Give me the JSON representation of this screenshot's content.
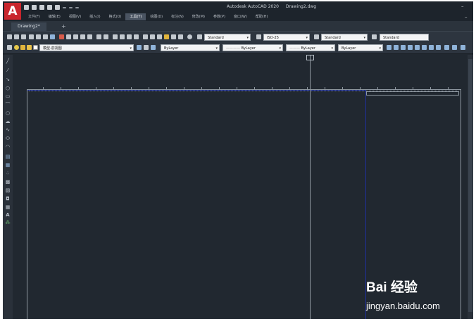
{
  "title": {
    "app_name": "Autodesk AutoCAD 2020",
    "file_name": "Drawing2.dwg"
  },
  "menu": [
    "文件(F)",
    "编辑(E)",
    "视图(V)",
    "插入(I)",
    "格式(O)",
    "工具(T)",
    "绘图(D)",
    "标注(N)",
    "修改(M)",
    "参数(P)",
    "窗口(W)",
    "帮助(H)"
  ],
  "menu_active_index": 5,
  "tabs": {
    "drawing": "Drawing2*",
    "add": "+"
  },
  "toolbar1": {
    "text_style": "Standard",
    "dim_style": "ISO-25",
    "table_style": "Standard",
    "multileader_style": "Standard"
  },
  "toolbar2": {
    "layer": "模型-前视图",
    "color": "ByLayer",
    "linetype": "ByLayer",
    "lineweight": "ByLayer",
    "plot_style": "ByLayer"
  },
  "watermark": {
    "logo": "Bai  经验",
    "url": "jingyan.baidu.com"
  },
  "colors": {
    "background": "#212830",
    "toolbar": "#2d353f",
    "app_red": "#c9262d",
    "paper_edge": "#1f2f9a"
  }
}
